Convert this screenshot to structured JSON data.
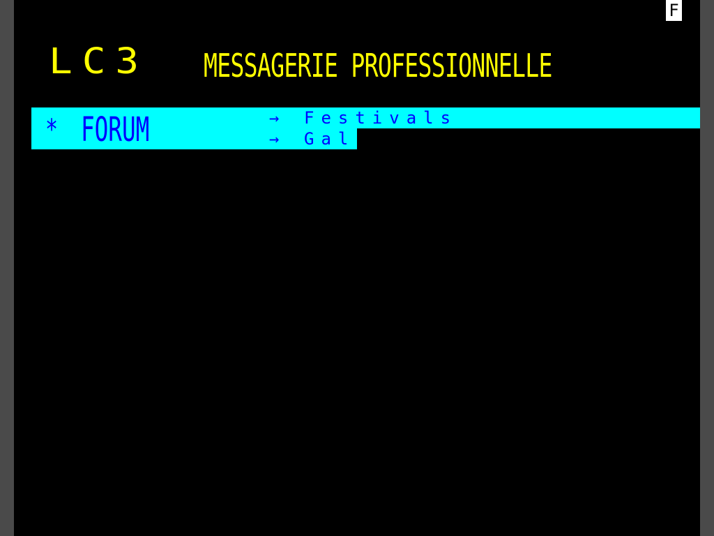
{
  "status": {
    "indicator": "F"
  },
  "header": {
    "logo": "LC3",
    "title": "MESSAGERIE PROFESSIONNELLE"
  },
  "menu": {
    "bullet": "*",
    "section_label": "FORUM",
    "items": [
      {
        "arrow": "→",
        "label": "Festivals"
      },
      {
        "arrow": "→",
        "label": "Gal"
      }
    ]
  },
  "colors": {
    "background": "#000000",
    "header_text": "#ffff00",
    "menu_bar": "#00ffff",
    "menu_text": "#0000ff",
    "status_box": "#ffffff"
  }
}
